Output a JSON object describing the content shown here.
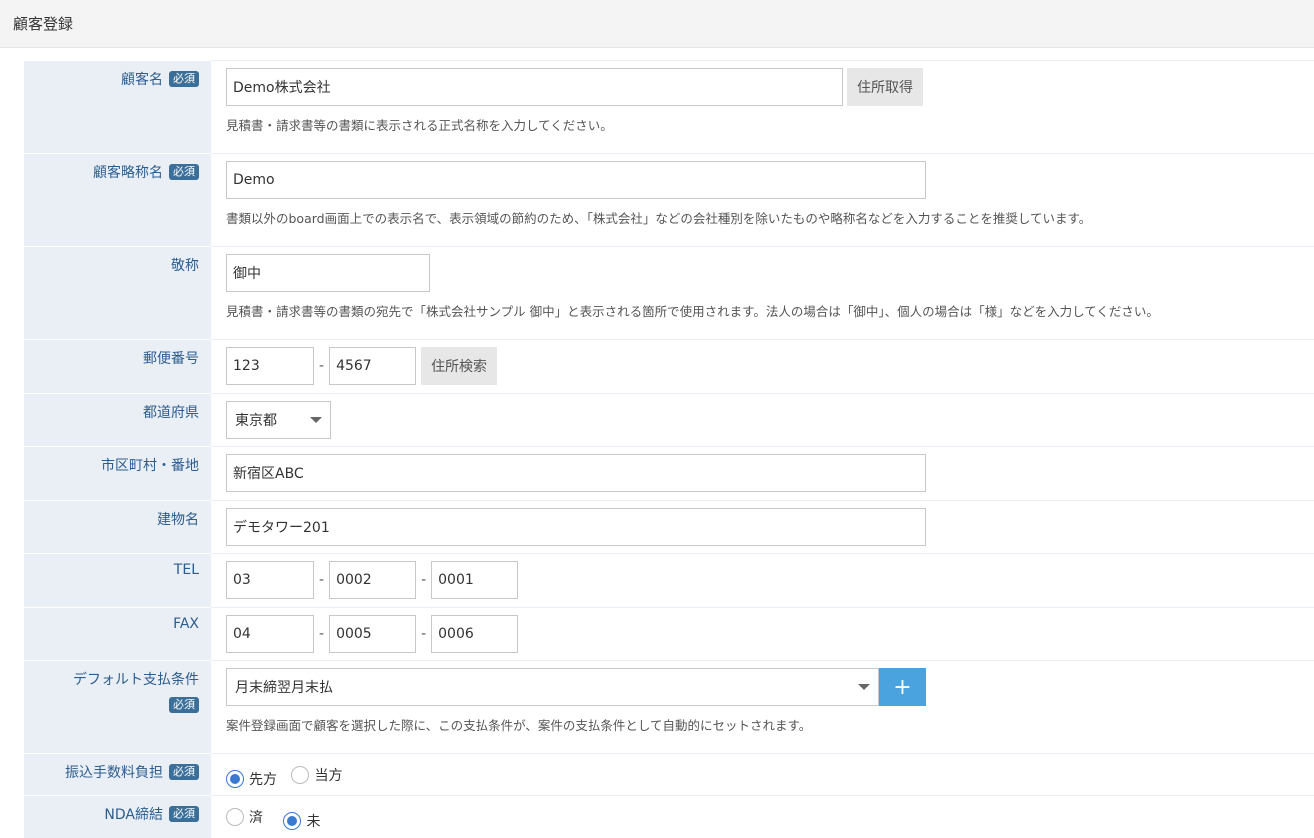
{
  "page": {
    "title": "顧客登録"
  },
  "required_label": "必須",
  "fields": {
    "customer_name": {
      "label": "顧客名",
      "value": "Demo株式会社",
      "button": "住所取得",
      "help": "見積書・請求書等の書類に表示される正式名称を入力してください。"
    },
    "short_name": {
      "label": "顧客略称名",
      "value": "Demo",
      "help": "書類以外のboard画面上での表示名で、表示領域の節約のため、「株式会社」などの会社種別を除いたものや略称名などを入力することを推奨しています。"
    },
    "honorific": {
      "label": "敬称",
      "value": "御中",
      "help": "見積書・請求書等の書類の宛先で「株式会社サンプル 御中」と表示される箇所で使用されます。法人の場合は「御中」、個人の場合は「様」などを入力してください。"
    },
    "postal": {
      "label": "郵便番号",
      "part1": "123",
      "part2": "4567",
      "button": "住所検索"
    },
    "prefecture": {
      "label": "都道府県",
      "value": "東京都"
    },
    "city": {
      "label": "市区町村・番地",
      "value": "新宿区ABC"
    },
    "building": {
      "label": "建物名",
      "value": "デモタワー201"
    },
    "tel": {
      "label": "TEL",
      "part1": "03",
      "part2": "0002",
      "part3": "0001"
    },
    "fax": {
      "label": "FAX",
      "part1": "04",
      "part2": "0005",
      "part3": "0006"
    },
    "payment": {
      "label": "デフォルト支払条件",
      "value": "月末締翌月末払",
      "add_button": "+",
      "help": "案件登録画面で顧客を選択した際に、この支払条件が、案件の支払条件として自動的にセットされます。"
    },
    "transfer_fee": {
      "label": "振込手数料負担",
      "options": [
        "先方",
        "当方"
      ],
      "selected": "先方"
    },
    "nda": {
      "label": "NDA締結",
      "options": [
        "済",
        "未"
      ],
      "selected": "未"
    }
  },
  "dash": "-",
  "colors": {
    "label_bg": "#eaeff6",
    "label_text": "#2c5d8f",
    "badge": "#3a6f9a",
    "accent": "#4aa3df",
    "radio": "#3a7ad0"
  }
}
